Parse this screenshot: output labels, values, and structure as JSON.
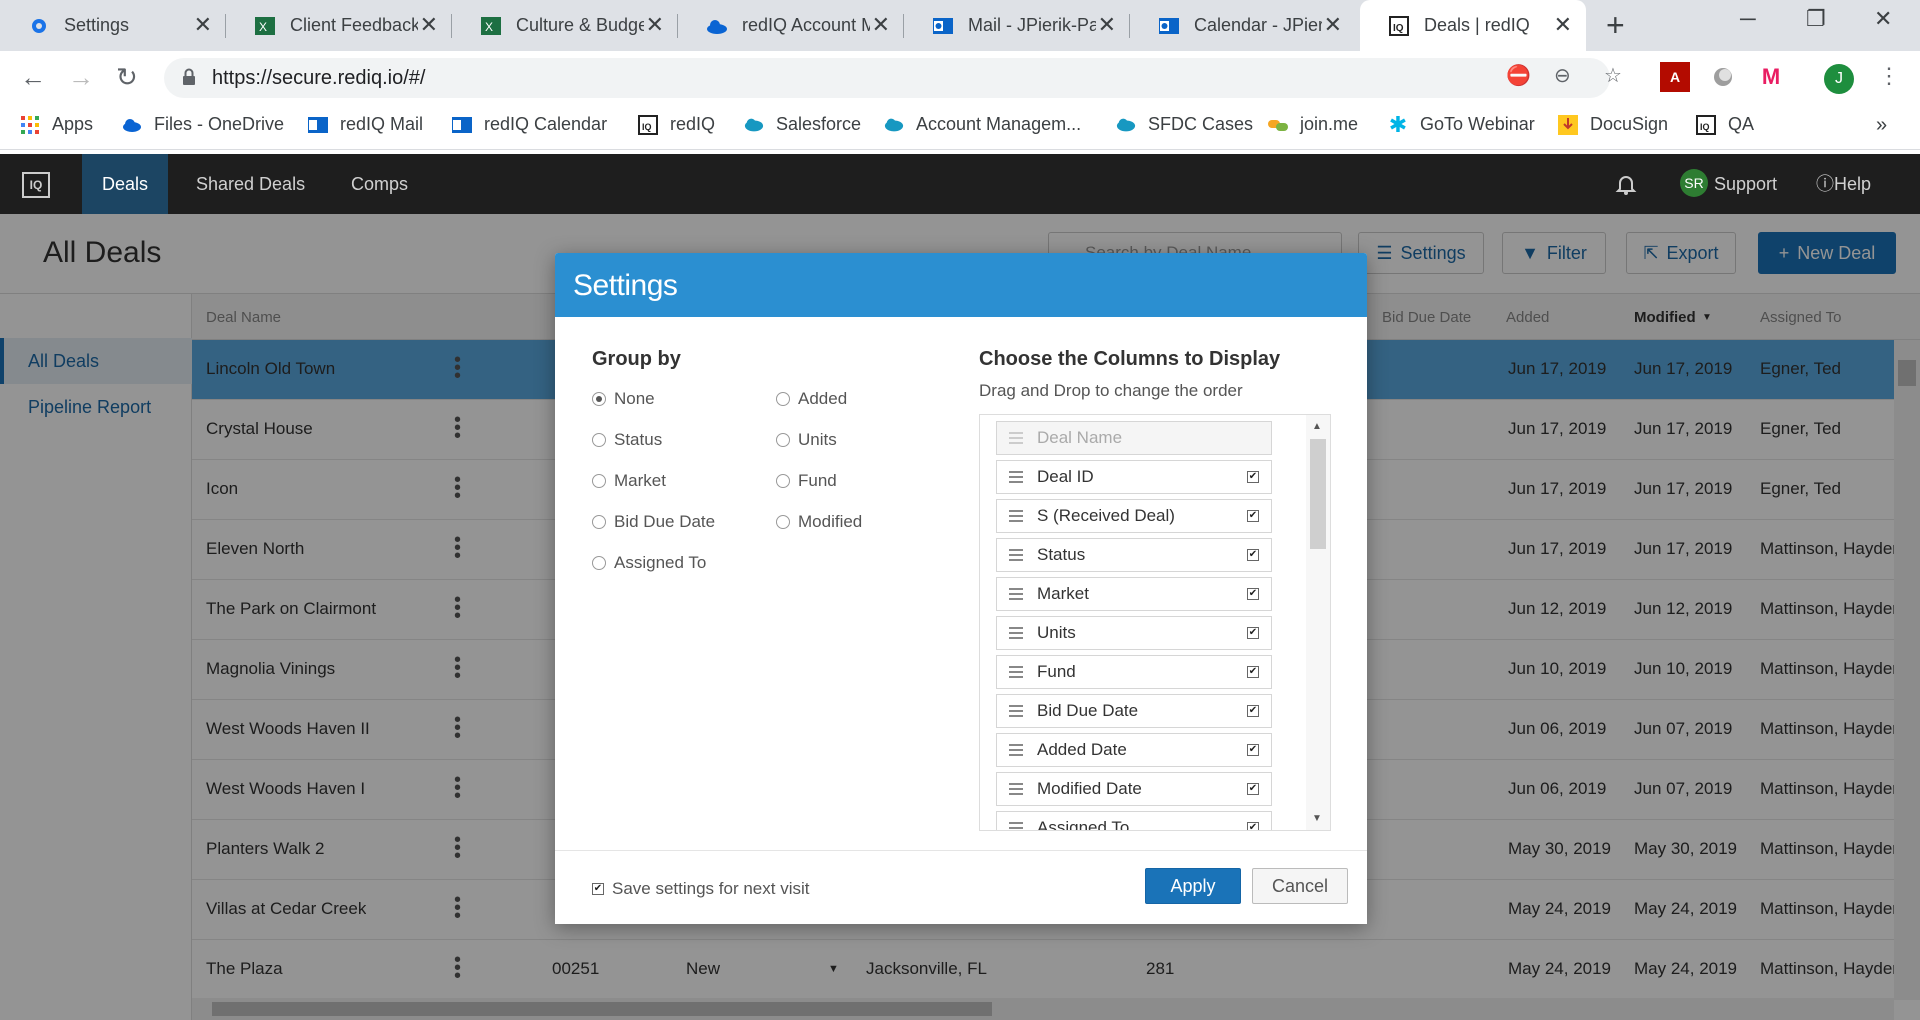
{
  "browser": {
    "tabs": [
      {
        "title": "Settings",
        "icon": "gear-icon"
      },
      {
        "title": "Client Feedback",
        "icon": "excel-icon"
      },
      {
        "title": "Culture & Budget",
        "icon": "excel-icon"
      },
      {
        "title": "redIQ Account Management",
        "icon": "onedrive-icon"
      },
      {
        "title": "Mail - JPierik-Pa",
        "icon": "outlook-icon"
      },
      {
        "title": "Calendar - JPierik",
        "icon": "outlook-icon"
      },
      {
        "title": "Deals | redIQ",
        "icon": "rediq-icon"
      }
    ],
    "url": "https://secure.rediq.io/#/",
    "profile_initial": "J",
    "bookmarks": [
      {
        "label": "Apps",
        "icon": "apps-grid-icon"
      },
      {
        "label": "Files - OneDrive",
        "icon": "onedrive-icon"
      },
      {
        "label": "redIQ Mail",
        "icon": "outlook-icon"
      },
      {
        "label": "redIQ Calendar",
        "icon": "outlook-icon"
      },
      {
        "label": "redIQ",
        "icon": "rediq-icon"
      },
      {
        "label": "Salesforce",
        "icon": "salesforce-icon"
      },
      {
        "label": "Account Managem...",
        "icon": "salesforce-icon"
      },
      {
        "label": "SFDC Cases",
        "icon": "salesforce-icon"
      },
      {
        "label": "join.me",
        "icon": "joinme-icon"
      },
      {
        "label": "GoTo Webinar",
        "icon": "gotowebinar-icon"
      },
      {
        "label": "DocuSign",
        "icon": "docusign-icon"
      },
      {
        "label": "QA",
        "icon": "rediq-icon"
      }
    ],
    "more_bookmarks": "»"
  },
  "app": {
    "nav": [
      "Deals",
      "Shared Deals",
      "Comps"
    ],
    "user_initials": "SR",
    "user_label": "Support",
    "help_label": "Help",
    "page_title": "All Deals",
    "search_placeholder": "Search by Deal Name",
    "buttons": {
      "settings": "Settings",
      "filter": "Filter",
      "export": "Export",
      "new_deal": "New Deal"
    },
    "sidebar": [
      "All Deals",
      "Pipeline Report"
    ],
    "columns": {
      "deal_name": "Deal Name",
      "bid_due_date": "Bid Due Date",
      "added": "Added",
      "modified": "Modified",
      "assigned_to": "Assigned To"
    },
    "rows": [
      {
        "name": "Lincoln Old Town",
        "added": "Jun 17, 2019",
        "modified": "Jun 17, 2019",
        "assigned": "Egner, Ted"
      },
      {
        "name": "Crystal House",
        "added": "Jun 17, 2019",
        "modified": "Jun 17, 2019",
        "assigned": "Egner, Ted"
      },
      {
        "name": "Icon",
        "added": "Jun 17, 2019",
        "modified": "Jun 17, 2019",
        "assigned": "Egner, Ted"
      },
      {
        "name": "Eleven North",
        "added": "Jun 17, 2019",
        "modified": "Jun 17, 2019",
        "assigned": "Mattinson, Hayden"
      },
      {
        "name": "The Park on Clairmont",
        "added": "Jun 12, 2019",
        "modified": "Jun 12, 2019",
        "assigned": "Mattinson, Hayden"
      },
      {
        "name": "Magnolia Vinings",
        "added": "Jun 10, 2019",
        "modified": "Jun 10, 2019",
        "assigned": "Mattinson, Hayden"
      },
      {
        "name": "West Woods Haven II",
        "added": "Jun 06, 2019",
        "modified": "Jun 07, 2019",
        "assigned": "Mattinson, Hayden"
      },
      {
        "name": "West Woods Haven I",
        "added": "Jun 06, 2019",
        "modified": "Jun 07, 2019",
        "assigned": "Mattinson, Hayden"
      },
      {
        "name": "Planters Walk 2",
        "added": "May 30, 2019",
        "modified": "May 30, 2019",
        "assigned": "Mattinson, Hayden"
      },
      {
        "name": "Villas at Cedar Creek",
        "added": "May 24, 2019",
        "modified": "May 24, 2019",
        "assigned": "Mattinson, Hayden"
      },
      {
        "name": "The Plaza",
        "deal_id": "00251",
        "status": "New",
        "market": "Jacksonville, FL",
        "units": "281",
        "added": "May 24, 2019",
        "modified": "May 24, 2019",
        "assigned": "Mattinson, Hayden"
      }
    ]
  },
  "modal": {
    "title": "Settings",
    "group_by_title": "Group by",
    "group_by_options": [
      {
        "label": "None",
        "selected": true
      },
      {
        "label": "Status",
        "selected": false
      },
      {
        "label": "Market",
        "selected": false
      },
      {
        "label": "Bid Due Date",
        "selected": false
      },
      {
        "label": "Assigned To",
        "selected": false
      },
      {
        "label": "Added",
        "selected": false
      },
      {
        "label": "Units",
        "selected": false
      },
      {
        "label": "Fund",
        "selected": false
      },
      {
        "label": "Modified",
        "selected": false
      }
    ],
    "columns_title": "Choose the Columns to Display",
    "columns_subtitle": "Drag and Drop to change the order",
    "columns": [
      {
        "label": "Deal Name",
        "checked": true,
        "locked": true
      },
      {
        "label": "Deal ID",
        "checked": true
      },
      {
        "label": "S (Received Deal)",
        "checked": true
      },
      {
        "label": "Status",
        "checked": true
      },
      {
        "label": "Market",
        "checked": true
      },
      {
        "label": "Units",
        "checked": true
      },
      {
        "label": "Fund",
        "checked": true
      },
      {
        "label": "Bid Due Date",
        "checked": true
      },
      {
        "label": "Added Date",
        "checked": true
      },
      {
        "label": "Modified Date",
        "checked": true
      },
      {
        "label": "Assigned To",
        "checked": true
      }
    ],
    "save_settings_label": "Save settings for next visit",
    "save_settings_checked": true,
    "apply_label": "Apply",
    "cancel_label": "Cancel"
  }
}
